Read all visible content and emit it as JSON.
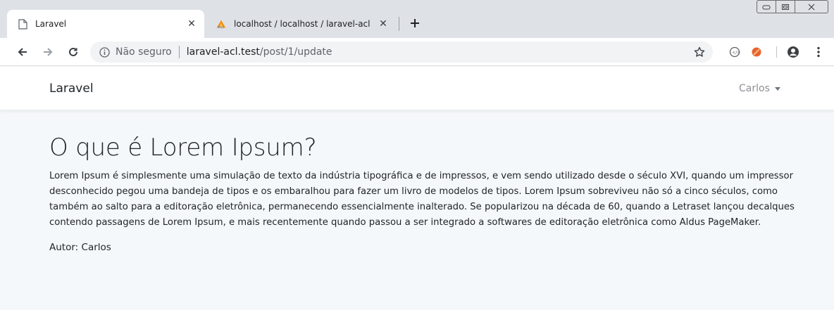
{
  "browser": {
    "tabs": [
      {
        "title": "Laravel",
        "favicon": "page-icon",
        "active": true
      },
      {
        "title": "localhost / localhost / laravel-acl",
        "favicon": "phpmyadmin-icon",
        "active": false
      }
    ],
    "address": {
      "security_label": "Não seguro",
      "host": "laravel-acl.test",
      "path": "/post/1/update"
    }
  },
  "navbar": {
    "brand": "Laravel",
    "user": "Carlos"
  },
  "post": {
    "title": "O que é Lorem Ipsum?",
    "body": "Lorem Ipsum é simplesmente uma simulação de texto da indústria tipográfica e de impressos, e vem sendo utilizado desde o século XVI, quando um impressor desconhecido pegou uma bandeja de tipos e os embaralhou para fazer um livro de modelos de tipos. Lorem Ipsum sobreviveu não só a cinco séculos, como também ao salto para a editoração eletrônica, permanecendo essencialmente inalterado. Se popularizou na década de 60, quando a Letraset lançou decalques contendo passagens de Lorem Ipsum, e mais recentemente quando passou a ser integrado a softwares de editoração eletrônica como Aldus PageMaker.",
    "author_label": "Autor:",
    "author_name": "Carlos"
  },
  "colors": {
    "tabstrip": "#dee1e6",
    "page_background": "#f5f8fa",
    "navbar_background": "#ffffff",
    "text": "#212529",
    "muted": "#8c9095"
  }
}
